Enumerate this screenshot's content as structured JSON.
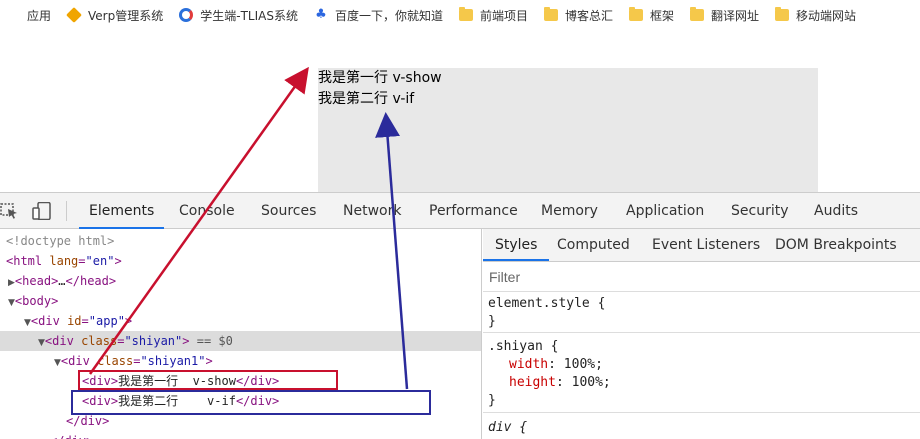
{
  "bookmarks": {
    "items": [
      {
        "label": "应用",
        "icon": "apps-grid-icon"
      },
      {
        "label": "Verp管理系统",
        "icon": "verp-icon"
      },
      {
        "label": "学生端-TLIAS系统",
        "icon": "tlias-icon"
      },
      {
        "label": "百度一下，你就知道",
        "icon": "baidu-paw-icon"
      },
      {
        "label": "前端项目",
        "icon": "folder-icon"
      },
      {
        "label": "博客总汇",
        "icon": "folder-icon"
      },
      {
        "label": "框架",
        "icon": "folder-icon"
      },
      {
        "label": "翻译网址",
        "icon": "folder-icon"
      },
      {
        "label": "移动端网站",
        "icon": "folder-icon"
      }
    ]
  },
  "page": {
    "line1": "我是第一行 v-show",
    "line2": "我是第二行 v-if",
    "background_color": "#e8e8e8"
  },
  "devtools": {
    "tabs": [
      "Elements",
      "Console",
      "Sources",
      "Network",
      "Performance",
      "Memory",
      "Application",
      "Security",
      "Audits"
    ],
    "active_tab": "Elements",
    "elements": {
      "doctype": "<!doctype html>",
      "html_tag": "html",
      "html_attr_name": "lang",
      "html_attr_value": "en",
      "head_collapsed": "…",
      "head_tag": "head",
      "body_tag": "body",
      "app_tag": "div",
      "app_attr_name": "id",
      "app_attr_value": "app",
      "shiyan_tag": "div",
      "shiyan_attr_name": "class",
      "shiyan_attr_value": "shiyan",
      "selected_marker": "== $0",
      "shiyan1_tag": "div",
      "shiyan1_attr_name": "class",
      "shiyan1_attr_value": "shiyan1",
      "row1_text": "我是第一行  v-show",
      "row2_text": "我是第二行    v-if",
      "closing_div": "</div>"
    },
    "styles": {
      "subtabs": [
        "Styles",
        "Computed",
        "Event Listeners",
        "DOM Breakpoints"
      ],
      "active_subtab": "Styles",
      "filter_placeholder": "Filter",
      "element_style_selector": "element.style {",
      "close_brace": "}",
      "shiyan_selector": ".shiyan {",
      "props": [
        {
          "name": "width",
          "value": "100%;"
        },
        {
          "name": "height",
          "value": "100%;"
        }
      ],
      "div_selector": "div {"
    }
  },
  "annotations": {
    "red_color": "#c8102e",
    "blue_color": "#2b2b9b"
  }
}
